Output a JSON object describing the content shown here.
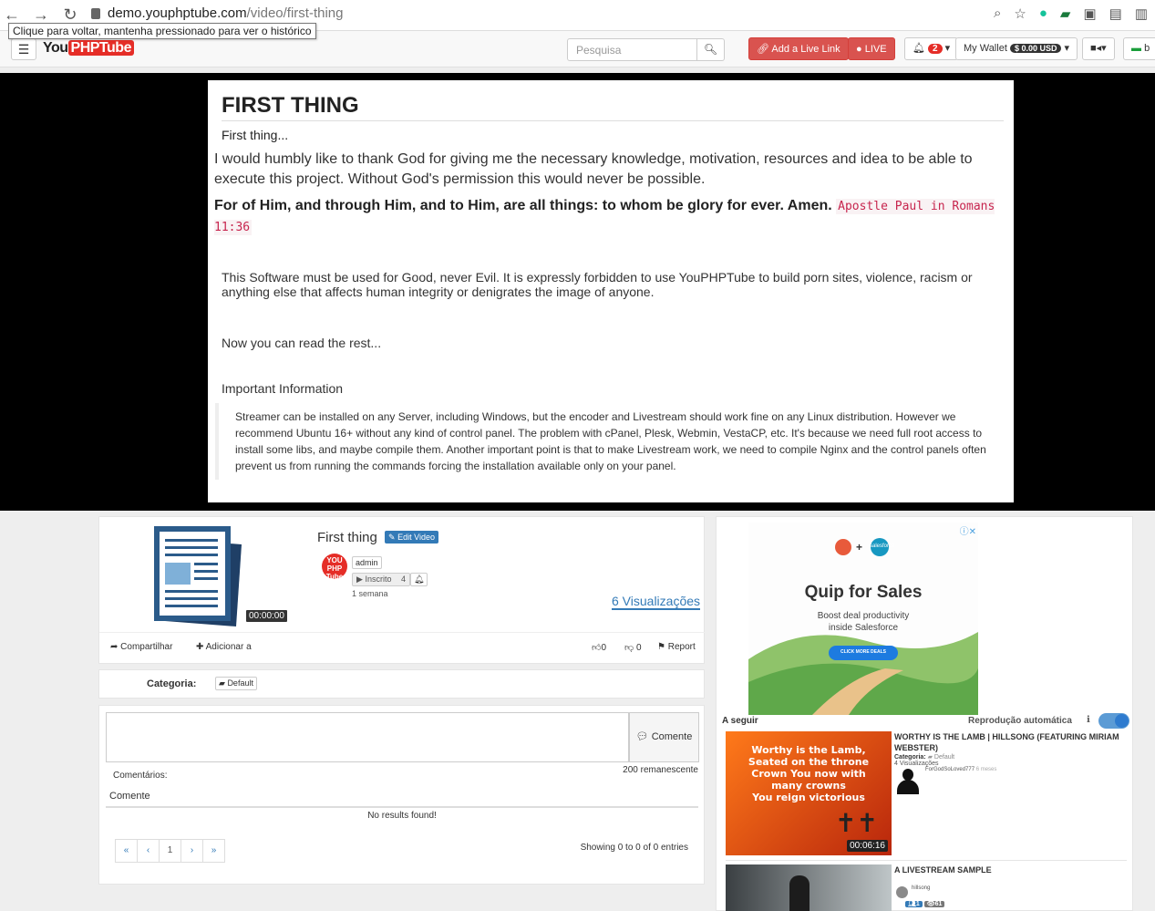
{
  "browser": {
    "url_domain": "demo.youphptube.com",
    "url_path": "/video/first-thing",
    "tooltip": "Clique para voltar, mantenha pressionado para ver o histórico"
  },
  "navbar": {
    "logo_you": "You",
    "logo_tube": "PHPTube",
    "search_placeholder": "Pesquisa",
    "add_live_link": "Add a Live Link",
    "live": "LIVE",
    "notif_count": "2",
    "wallet_label": "My Wallet",
    "wallet_amount": "$ 0.00 USD",
    "lang_partial": "b"
  },
  "article": {
    "title": "FIRST THING",
    "intro": "First thing...",
    "thanks": "I would humbly like to thank God for giving me the necessary knowledge, motivation, resources and idea to be able to execute this project. Without God's permission this would never be possible.",
    "verse": "For of Him, and through Him, and to Him, are all things: to whom be glory for ever. Amen.",
    "verse_ref": "Apostle Paul in Romans 11:36",
    "good": "This Software must be used for Good, never Evil. It is expressly forbidden to use YouPHPTube to build porn sites, violence, racism or anything else that affects human integrity or denigrates the image of anyone.",
    "read_rest": "Now you can read the rest...",
    "important": "Important Information",
    "quote": "Streamer can be installed on any Server, including Windows, but the encoder and Livestream should work fine on any Linux distribution. However we recommend Ubuntu 16+ without any kind of control panel. The problem with cPanel, Plesk, Webmin, VestaCP, etc. It's because we need full root access to install some libs, and maybe compile them. Another important point is that to make Livestream work, we need to compile Nginx and the control panels often prevent us from running the commands forcing the installation available only on your panel."
  },
  "video": {
    "title": "First thing",
    "edit": "Edit Video",
    "duration": "00:00:00",
    "user": "admin",
    "subscribe": "Inscrito",
    "subscribers": "4",
    "age": "1 semana",
    "views": "6 Visualizações",
    "share": "Compartilhar",
    "add_to": "Adicionar a",
    "likes": "0",
    "dislikes": "0",
    "report": "Report"
  },
  "category": {
    "label": "Categoria:",
    "value": "Default"
  },
  "comments": {
    "button": "Comente",
    "label": "Comentários:",
    "remaining": "200 remanescente",
    "column": "Comente",
    "empty": "No results found!",
    "showing": "Showing 0 to 0 of 0 entries",
    "pages": [
      "«",
      "‹",
      "1",
      "›",
      "»"
    ]
  },
  "ad": {
    "title": "Quip for Sales",
    "sub1": "Boost deal productivity",
    "sub2": "inside Salesforce",
    "cta": "CLICK MORE DEALS",
    "brand": "salesforce"
  },
  "sidebar": {
    "next": "A seguir",
    "autoplay": "Reprodução automática",
    "videos": [
      {
        "title": "WORTHY IS THE LAMB | HILLSONG (FEATURING MIRIAM WEBSTER)",
        "category_label": "Categoria:",
        "category": "Default",
        "views": "4 Visualizações",
        "channel": "ForGodSoLoved777",
        "age": "6 meses",
        "duration": "00:06:16",
        "thumb_lines": [
          "Worthy is the Lamb,",
          "Seated on the throne",
          "Crown You now with",
          "many crowns",
          "You reign victorious"
        ]
      },
      {
        "title": "A LIVESTREAM SAMPLE",
        "channel": "hillsong",
        "count1": "1",
        "count2": "61"
      }
    ]
  },
  "colors": {
    "brand_red": "#e52d27",
    "link_blue": "#337ab7",
    "code_pink": "#c7254e"
  }
}
